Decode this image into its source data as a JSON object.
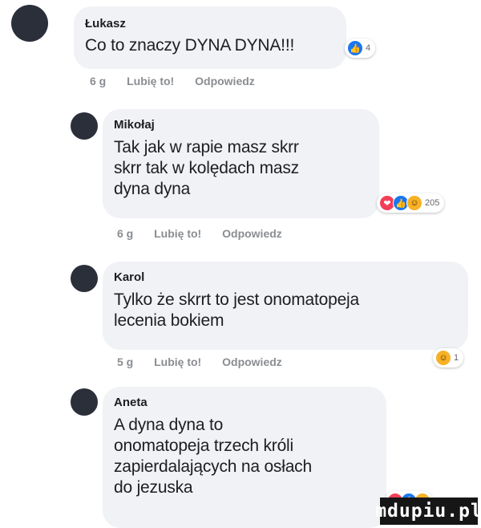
{
  "comments": [
    {
      "author": "Łukasz",
      "lines": [
        "Co to znaczy DYNA DYNA!!!"
      ],
      "time": "6 g",
      "like": "Lubię to!",
      "reply": "Odpowiedz",
      "reactions": {
        "icons": [
          "like-icon"
        ],
        "count": "4"
      }
    },
    {
      "author": "Mikołaj",
      "lines": [
        "Tak jak w rapie masz skrr",
        "skrr tak w kolędach masz",
        "dyna dyna"
      ],
      "time": "6 g",
      "like": "Lubię to!",
      "reply": "Odpowiedz",
      "reactions": {
        "icons": [
          "love-icon",
          "like-icon",
          "haha-icon"
        ],
        "count": "205"
      }
    },
    {
      "author": "Karol",
      "lines": [
        "Tylko że skrrt to jest onomatopeja",
        "lecenia bokiem"
      ],
      "time": "5 g",
      "like": "Lubię to!",
      "reply": "Odpowiedz",
      "reactions": {
        "icons": [
          "haha-icon"
        ],
        "count": "1"
      }
    },
    {
      "author": "Aneta",
      "lines": [
        "A dyna dyna to",
        "onomatopeja trzech króli",
        "zapierdalających na osłach",
        "do jezuska"
      ],
      "time": "",
      "like": "",
      "reply": "",
      "reactions": {
        "icons": [
          "love-icon",
          "like-icon",
          "haha-icon"
        ],
        "count": ""
      }
    }
  ],
  "watermark": "mdupiu.pl",
  "colors": {
    "like": "#1877f2",
    "love": "#f33e58",
    "haha": "#f7b125",
    "bubble": "#f0f2f5"
  }
}
